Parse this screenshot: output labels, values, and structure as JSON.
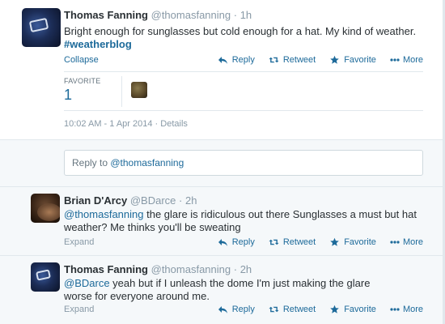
{
  "main_tweet": {
    "fullname": "Thomas Fanning",
    "username": "@thomasfanning",
    "time": "1h",
    "text_line1": "Bright enough for sunglasses but cold enough for a hat. My kind of weather.",
    "hashtag": "#weatherblog",
    "collapse_label": "Collapse",
    "actions": {
      "reply": "Reply",
      "retweet": "Retweet",
      "favorite": "Favorite",
      "more": "More"
    },
    "stats": {
      "favorite_label": "FAVORITE",
      "favorite_count": "1"
    },
    "timestamp": "10:02 AM - 1 Apr 2014",
    "details_label": "Details"
  },
  "reply_box": {
    "prefix": "Reply to ",
    "username": "@thomasfanning"
  },
  "replies": [
    {
      "fullname": "Brian D'Arcy",
      "username": "@BDarce",
      "time": "2h",
      "mention": "@thomasfanning",
      "text": " the glare is ridiculous out there Sunglasses a must but hat weather? Me thinks you'll be sweating",
      "expand_label": "Expand",
      "actions": {
        "reply": "Reply",
        "retweet": "Retweet",
        "favorite": "Favorite",
        "more": "More"
      }
    },
    {
      "fullname": "Thomas Fanning",
      "username": "@thomasfanning",
      "time": "2h",
      "mention": "@BDarce",
      "text": " yeah but if I unleash the dome I'm just making the glare worse for everyone around me.",
      "expand_label": "Expand",
      "actions": {
        "reply": "Reply",
        "retweet": "Retweet",
        "favorite": "Favorite",
        "more": "More"
      }
    }
  ],
  "colors": {
    "link": "#1d6a9a",
    "muted": "#8899a6",
    "text": "#292f33",
    "bg_alt": "#f5f8fa"
  },
  "icons": [
    "reply-icon",
    "retweet-icon",
    "favorite-icon",
    "more-icon"
  ]
}
